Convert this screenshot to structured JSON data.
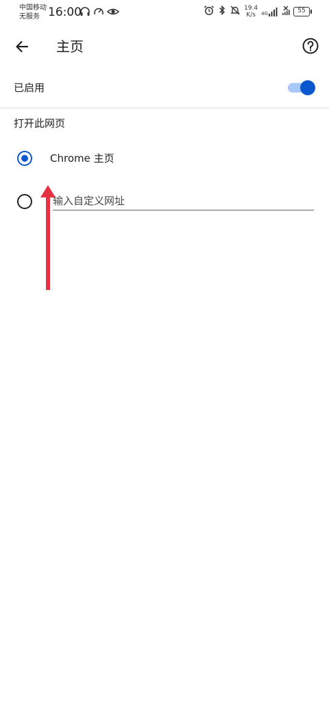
{
  "status_bar": {
    "carrier_line1": "中国移动",
    "carrier_line2": "无服务",
    "time": "16:00",
    "net_speed_value": "19.4",
    "net_speed_unit": "K/s",
    "net_type": "4G",
    "battery_level": "55",
    "icons_left": [
      "headphones-icon",
      "speedometer-icon",
      "eye-icon"
    ],
    "icons_right": [
      "alarm-icon",
      "bluetooth-icon",
      "mute-bell-icon",
      "signal-icon",
      "no-sim-icon",
      "battery-icon"
    ]
  },
  "app_bar": {
    "title": "主页",
    "back_icon": "arrow-back-icon",
    "help_icon": "help-circle-icon"
  },
  "enabled_setting": {
    "label": "已启用",
    "on": true
  },
  "section": {
    "title": "打开此网页",
    "options": [
      {
        "label": "Chrome 主页",
        "selected": true
      },
      {
        "label": "",
        "placeholder": "输入自定义网址",
        "selected": false
      }
    ]
  },
  "colors": {
    "accent": "#0b57d0",
    "accent_track": "#a8c7fa",
    "annotation": "#e53141"
  }
}
